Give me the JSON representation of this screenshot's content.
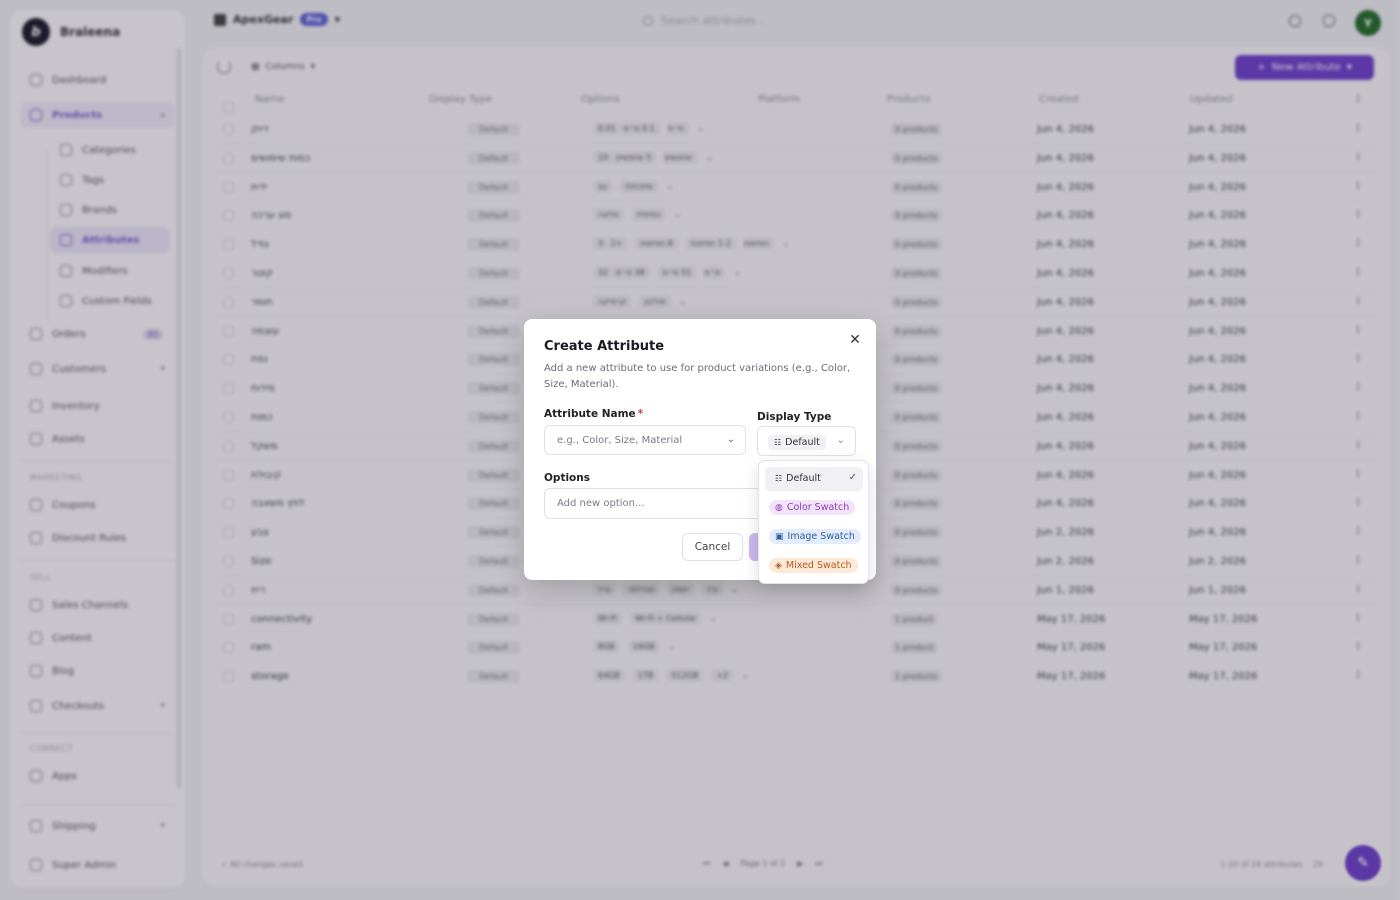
{
  "sidebar": {
    "brand": "Braleena",
    "items": {
      "dashboard": "Dashboard",
      "products": "Products",
      "categories": "Categories",
      "tags": "Tags",
      "brands": "Brands",
      "attributes": "Attributes",
      "modifiers": "Modifiers",
      "custom_fields": "Custom Fields",
      "orders": "Orders",
      "orders_badge": "83",
      "customers": "Customers",
      "inventory": "Inventory",
      "assets": "Assets",
      "marketing_label": "MARKETING",
      "coupons": "Coupons",
      "discount_rules": "Discount Rules",
      "sell_label": "SELL",
      "sales_channels": "Sales Channels",
      "content": "Content",
      "blog": "Blog",
      "checkouts": "Checkouts",
      "connect_label": "CONNECT",
      "apps": "Apps",
      "shipping": "Shipping",
      "super_admin": "Super Admin"
    }
  },
  "topbar": {
    "store": "ApexGear",
    "plan_badge": "Pro",
    "search_placeholder": "Search attributes...",
    "avatar_initial": "Y"
  },
  "main": {
    "columns_label": "Columns",
    "new_button": "New Attribute",
    "headers": [
      "Name",
      "Display Type",
      "Options",
      "Platform",
      "Products",
      "Created",
      "Updated"
    ],
    "rows": [
      {
        "name": "דיוק",
        "type": "Default",
        "options": [
          "0.01 מ״מ",
          "0.1 מ״מ"
        ],
        "more": "",
        "products": "0 products",
        "created": "Jun 4, 2026",
        "updated": "Jun 4, 2026"
      },
      {
        "name": "כמות שימושים",
        "type": "Default",
        "options": [
          "10 שימושים",
          "5 שימושים"
        ],
        "more": "",
        "products": "0 products",
        "created": "Jun 4, 2026",
        "updated": "Jun 4, 2026"
      },
      {
        "name": "ידית",
        "type": "Default",
        "options": [
          "מתכתית",
          "עץ"
        ],
        "more": "",
        "products": "0 products",
        "created": "Jun 4, 2026",
        "updated": "Jun 4, 2026"
      },
      {
        "name": "סוג ערכה",
        "type": "Default",
        "options": [
          "בסיסית",
          "מלאה"
        ],
        "more": "",
        "products": "0 products",
        "created": "Jun 4, 2026",
        "updated": "Jun 4, 2026"
      },
      {
        "name": "גודל",
        "type": "Default",
        "options": [
          "3 חפיסות",
          "1-2 חפיסות",
          "8 חפיסות"
        ],
        "more": "+2",
        "products": "0 products",
        "created": "Jun 4, 2026",
        "updated": "Jun 4, 2026"
      },
      {
        "name": "קוטר",
        "type": "Default",
        "options": [
          "32 מ״מ",
          "51 מ״מ",
          "38 מ״מ"
        ],
        "more": "",
        "products": "0 products",
        "created": "Jun 4, 2026",
        "updated": "Jun 4, 2026"
      },
      {
        "name": "חומר",
        "type": "Default",
        "options": [
          "פוליגון",
          "קרמיקה"
        ],
        "more": "",
        "products": "0 products",
        "created": "Jun 4, 2026",
        "updated": "Jun 4, 2026"
      },
      {
        "name": "עוצמה",
        "type": "Default",
        "options": [],
        "more": "",
        "products": "0 products",
        "created": "Jun 4, 2026",
        "updated": "Jun 4, 2026"
      },
      {
        "name": "נפח",
        "type": "Default",
        "options": [],
        "more": "",
        "products": "0 products",
        "created": "Jun 4, 2026",
        "updated": "Jun 4, 2026"
      },
      {
        "name": "מידות",
        "type": "Default",
        "options": [],
        "more": "",
        "products": "0 products",
        "created": "Jun 4, 2026",
        "updated": "Jun 4, 2026"
      },
      {
        "name": "כמות",
        "type": "Default",
        "options": [],
        "more": "",
        "products": "0 products",
        "created": "Jun 4, 2026",
        "updated": "Jun 4, 2026"
      },
      {
        "name": "משקל",
        "type": "Default",
        "options": [],
        "more": "",
        "products": "0 products",
        "created": "Jun 4, 2026",
        "updated": "Jun 4, 2026"
      },
      {
        "name": "קיבולת",
        "type": "Default",
        "options": [],
        "more": "",
        "products": "0 products",
        "created": "Jun 4, 2026",
        "updated": "Jun 4, 2026"
      },
      {
        "name": "לחץ משאבה",
        "type": "Default",
        "options": [],
        "more": "",
        "products": "0 products",
        "created": "Jun 4, 2026",
        "updated": "Jun 4, 2026"
      },
      {
        "name": "צבע",
        "type": "Default",
        "options": [],
        "more": "",
        "products": "0 products",
        "created": "Jun 2, 2026",
        "updated": "Jun 4, 2026"
      },
      {
        "name": "Size",
        "type": "Default",
        "options": [],
        "more": "",
        "products": "0 products",
        "created": "Jun 2, 2026",
        "updated": "Jun 2, 2026"
      },
      {
        "name": "ריח",
        "type": "Default",
        "options": [
          "ורד",
          "יסמין",
          "סנדלווד",
          "נרד"
        ],
        "more": "",
        "products": "0 products",
        "created": "Jun 1, 2026",
        "updated": "Jun 1, 2026"
      },
      {
        "name": "connectivity",
        "type": "Default",
        "options": [
          "Wi-Fi",
          "Wi-Fi + Cellular"
        ],
        "more": "",
        "products": "1 product",
        "created": "May 17, 2026",
        "updated": "May 17, 2026"
      },
      {
        "name": "ram",
        "type": "Default",
        "options": [
          "8GB",
          "16GB"
        ],
        "more": "",
        "products": "1 product",
        "created": "May 17, 2026",
        "updated": "May 17, 2026"
      },
      {
        "name": "storage",
        "type": "Default",
        "options": [
          "64GB",
          "1TB",
          "512GB"
        ],
        "more": "+2",
        "products": "1 products",
        "created": "May 17, 2026",
        "updated": "May 17, 2026"
      }
    ],
    "status": "All changes saved",
    "page_label": "Page 1 of 2",
    "count": "1-20 of 24 attributes",
    "per_page": "20"
  },
  "dialog": {
    "title": "Create Attribute",
    "description": "Add a new attribute to use for product variations (e.g., Color, Size, Material).",
    "name_label": "Attribute Name",
    "required_mark": "*",
    "name_placeholder": "e.g., Color, Size, Material",
    "display_type_label": "Display Type",
    "display_type_value": "Default",
    "options_label": "Options",
    "options_placeholder": "Add new option...",
    "cancel": "Cancel",
    "close_icon": "✕"
  },
  "dropdown": {
    "items": [
      "Default",
      "Color Swatch",
      "Image Swatch",
      "Mixed Swatch"
    ],
    "selected": "Default"
  },
  "colors": {
    "accent": "#6d3fc9",
    "color_swatch": "#8a3db5",
    "image_swatch": "#2f5ea8",
    "mixed_swatch": "#b35a1c"
  }
}
